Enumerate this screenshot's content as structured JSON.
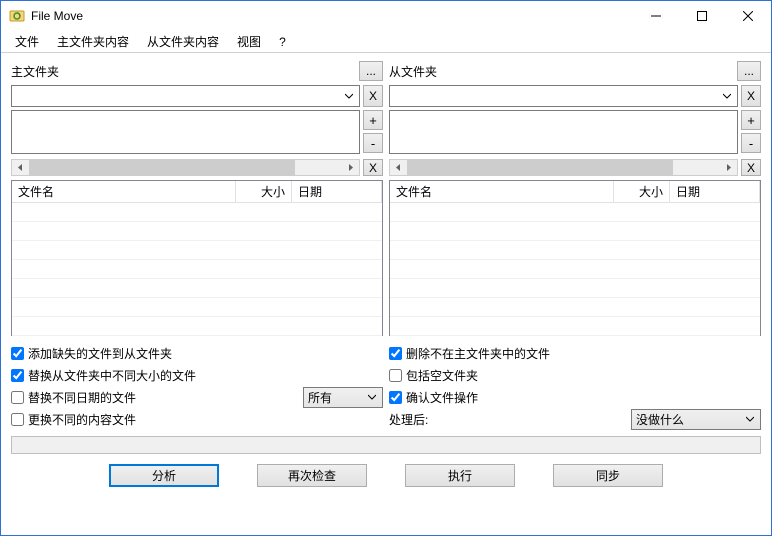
{
  "window": {
    "title": "File Move"
  },
  "menu": {
    "file": "文件",
    "mainContent": "主文件夹内容",
    "subContent": "从文件夹内容",
    "view": "视图",
    "help": "?"
  },
  "panels": {
    "main": {
      "label": "主文件夹",
      "browse": "...",
      "remove": "X",
      "plus": "+",
      "minus": "-",
      "clear": "X"
    },
    "sub": {
      "label": "从文件夹",
      "browse": "...",
      "remove": "X",
      "plus": "+",
      "minus": "-",
      "clear": "X"
    }
  },
  "grid": {
    "colName": "文件名",
    "colSize": "大小",
    "colDate": "日期"
  },
  "options": {
    "left": {
      "addMissing": {
        "label": "添加缺失的文件到从文件夹",
        "checked": true
      },
      "replaceSize": {
        "label": "替换从文件夹中不同大小的文件",
        "checked": true
      },
      "replaceDate": {
        "label": "替换不同日期的文件",
        "checked": false
      },
      "replaceContent": {
        "label": "更换不同的内容文件",
        "checked": false
      },
      "dateFilter": "所有"
    },
    "right": {
      "deleteNotMain": {
        "label": "删除不在主文件夹中的文件",
        "checked": true
      },
      "includeEmpty": {
        "label": "包括空文件夹",
        "checked": false
      },
      "confirmOps": {
        "label": "确认文件操作",
        "checked": true
      },
      "afterLabel": "处理后:",
      "afterValue": "没做什么"
    }
  },
  "buttons": {
    "analyze": "分析",
    "recheck": "再次检查",
    "execute": "执行",
    "sync": "同步"
  }
}
